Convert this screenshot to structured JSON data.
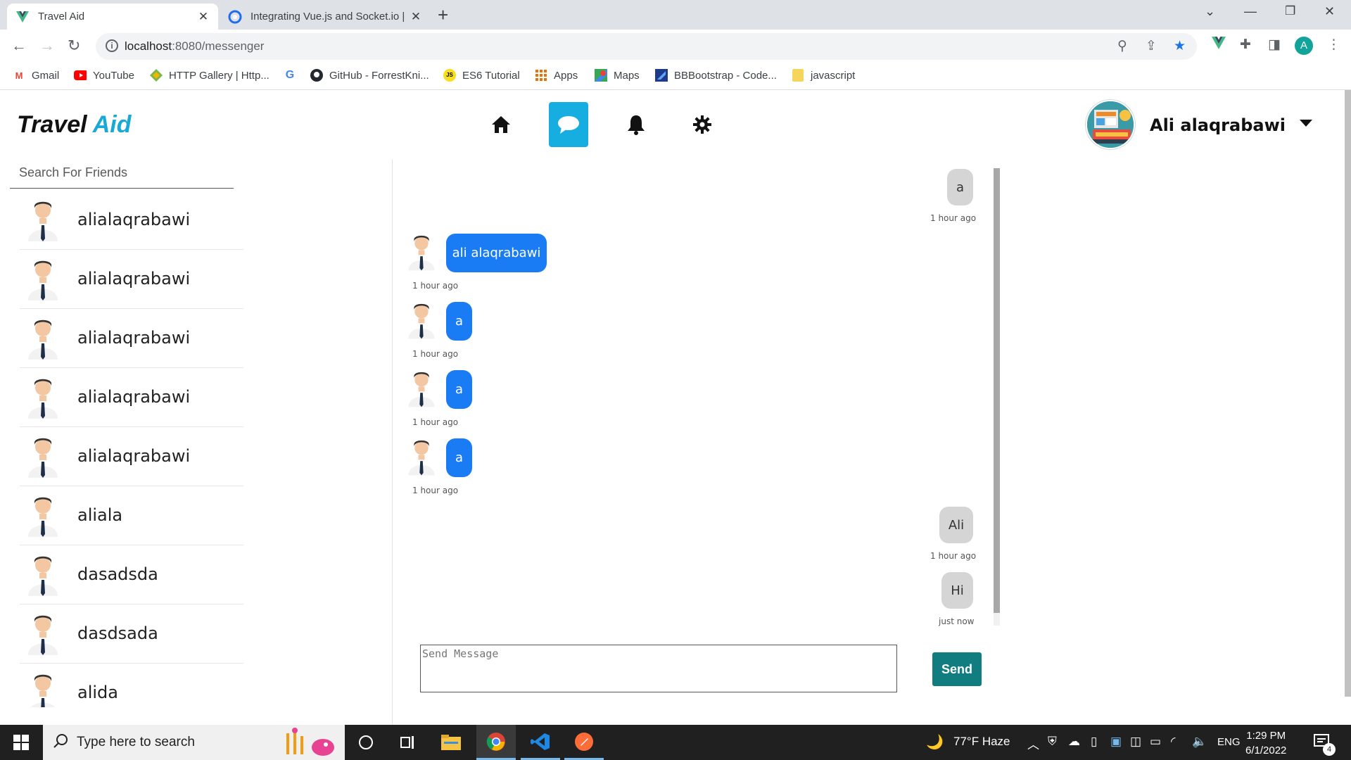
{
  "browser": {
    "tabs": [
      {
        "title": "Travel Aid",
        "icon": "vue-icon",
        "active": true
      },
      {
        "title": "Integrating Vue.js and Socket.io |",
        "icon": "socketio-icon",
        "active": false
      }
    ],
    "url_host": "localhost",
    "url_path": ":8080/messenger",
    "profile_initial": "A",
    "bookmarks": [
      {
        "label": "Gmail",
        "icon": "gmail-icon"
      },
      {
        "label": "YouTube",
        "icon": "youtube-icon"
      },
      {
        "label": "HTTP Gallery | Http...",
        "icon": "http-gallery-icon"
      },
      {
        "label": "",
        "icon": "google-icon"
      },
      {
        "label": "GitHub - ForrestKni...",
        "icon": "github-icon"
      },
      {
        "label": "ES6 Tutorial",
        "icon": "js-icon"
      },
      {
        "label": "Apps",
        "icon": "apps-grid-icon"
      },
      {
        "label": "Maps",
        "icon": "maps-icon"
      },
      {
        "label": "BBBootstrap - Code...",
        "icon": "bbbootstrap-icon"
      },
      {
        "label": "javascript",
        "icon": "folder-icon"
      }
    ]
  },
  "app": {
    "logo_part1": "Travel",
    "logo_part2": "Aid",
    "nav": [
      "home-icon",
      "chat-icon",
      "bell-icon",
      "gear-icon"
    ],
    "active_nav": "chat-icon",
    "user_name": "Ali alaqrabawi",
    "accent": "#16aee0",
    "search_placeholder": "Search For Friends",
    "friends": [
      "alialaqrabawi",
      "alialaqrabawi",
      "alialaqrabawi",
      "alialaqrabawi",
      "alialaqrabawi",
      "aliala",
      "dasadsda",
      "dasdsada",
      "alida"
    ]
  },
  "chat": {
    "messages": [
      {
        "text": "a",
        "from": "me",
        "time": "1 hour ago"
      },
      {
        "text": "ali alaqrabawi",
        "from": "them",
        "time": "1 hour ago"
      },
      {
        "text": "a",
        "from": "them",
        "time": "1 hour ago"
      },
      {
        "text": "a",
        "from": "them",
        "time": "1 hour ago"
      },
      {
        "text": "a",
        "from": "them",
        "time": "1 hour ago"
      },
      {
        "text": "Ali",
        "from": "me",
        "time": "1 hour ago"
      },
      {
        "text": "Hi",
        "from": "me",
        "time": "just now"
      }
    ],
    "input_placeholder": "Send Message",
    "send_label": "Send",
    "bubble_me_color": "#d5d5d5",
    "bubble_them_color": "#1a7cf5",
    "send_color": "#127d80"
  },
  "taskbar": {
    "search_text": "Type here to search",
    "weather": "77°F  Haze",
    "lang": "ENG",
    "time": "1:29 PM",
    "date": "6/1/2022",
    "notifications": "4"
  }
}
